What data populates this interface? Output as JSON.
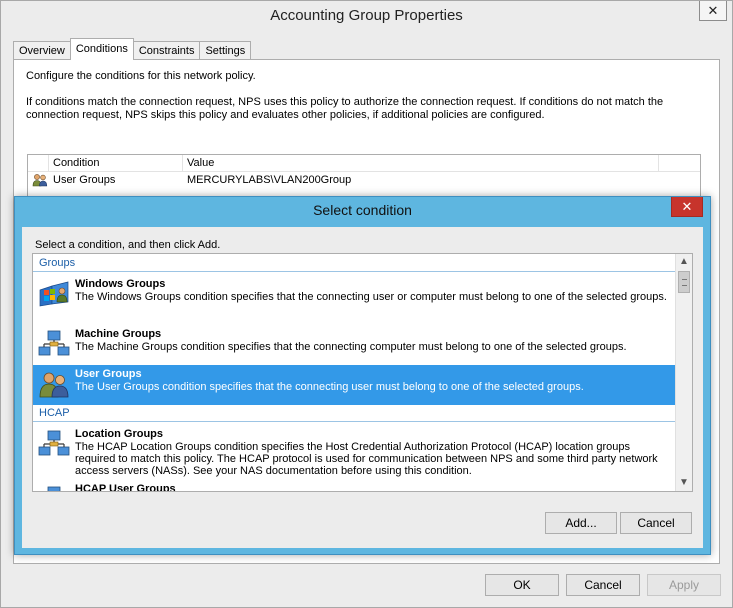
{
  "window": {
    "title": "Accounting Group Properties",
    "close": "✕"
  },
  "tabs": [
    {
      "label": "Overview"
    },
    {
      "label": "Conditions"
    },
    {
      "label": "Constraints"
    },
    {
      "label": "Settings"
    }
  ],
  "panel": {
    "intro": "Configure the conditions for this network policy.",
    "description": "If conditions match the connection request, NPS uses this policy to authorize the connection request. If conditions do not match the connection request, NPS skips this policy and evaluates other policies, if additional policies are configured."
  },
  "conditions_table": {
    "headers": [
      "Condition",
      "Value"
    ],
    "rows": [
      {
        "condition": "User Groups",
        "value": "MERCURYLABS\\VLAN200Group"
      }
    ]
  },
  "dialog": {
    "title": "Select condition",
    "close": "✕",
    "prompt": "Select a condition, and then click Add.",
    "groups": [
      {
        "name": "Groups",
        "items": [
          {
            "title": "Windows Groups",
            "desc": "The Windows Groups condition specifies that the connecting user or computer must belong to one of the selected groups."
          },
          {
            "title": "Machine Groups",
            "desc": "The Machine Groups condition specifies that the connecting computer must belong to one of the selected groups."
          },
          {
            "title": "User Groups",
            "desc": "The User Groups condition specifies that the connecting user must belong to one of the selected groups.",
            "selected": true
          }
        ]
      },
      {
        "name": "HCAP",
        "items": [
          {
            "title": "Location Groups",
            "desc": "The HCAP Location Groups condition specifies the Host Credential Authorization Protocol (HCAP) location groups required to match this policy. The HCAP protocol is used for communication between NPS and some third party network access servers (NASs). See your NAS documentation before using this condition."
          },
          {
            "title": "HCAP User Groups",
            "desc": ""
          }
        ]
      }
    ],
    "add_label": "Add...",
    "cancel_label": "Cancel"
  },
  "footer": {
    "ok_label": "OK",
    "cancel_label": "Cancel",
    "apply_label": "Apply"
  },
  "colors": {
    "selection": "#3399e8",
    "dialog_frame": "#5eb6e0",
    "close_button": "#c7342c",
    "group_header": "#1c5fa8"
  },
  "icons": {
    "groups": "user-group-icon",
    "windows": "windows-group-icon",
    "machine": "network-computers-icon",
    "location": "network-computers-icon"
  }
}
